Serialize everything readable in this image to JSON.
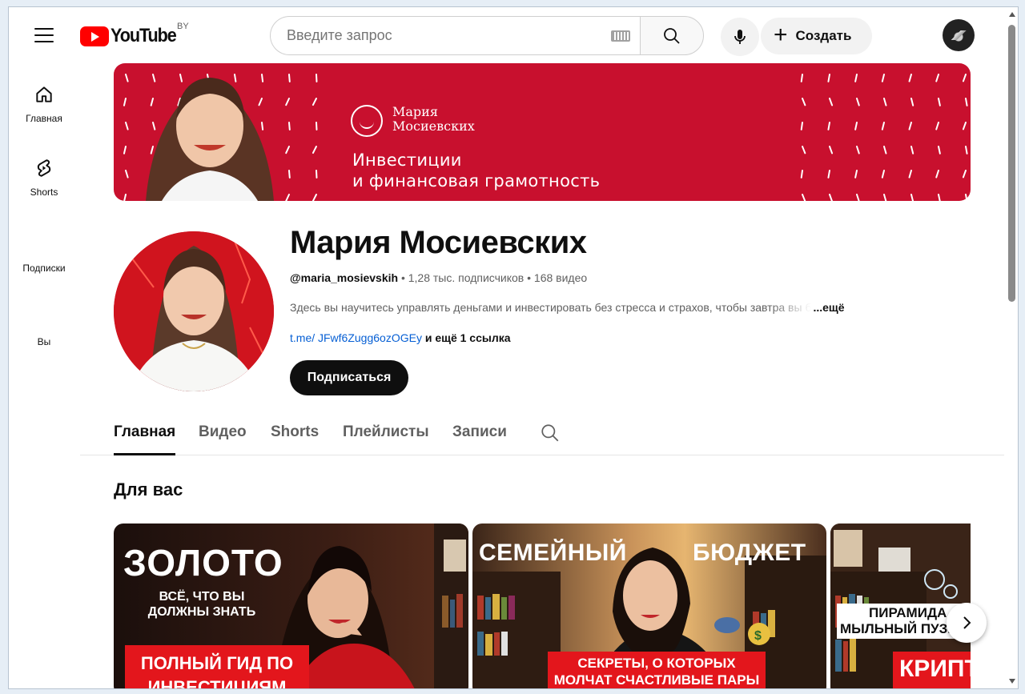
{
  "header": {
    "logo_text": "YouTube",
    "region": "BY",
    "search_placeholder": "Введите запрос",
    "create_label": "Создать"
  },
  "sidebar": {
    "items": [
      {
        "label": "Главная",
        "icon": "home-icon"
      },
      {
        "label": "Shorts",
        "icon": "shorts-icon"
      },
      {
        "label": "Подписки",
        "icon": "subscriptions-icon"
      },
      {
        "label": "Вы",
        "icon": "you-icon"
      }
    ]
  },
  "banner": {
    "name": [
      "Мария",
      "Мосиевских"
    ],
    "tagline": [
      "Инвестиции",
      "и финансовая грамотность"
    ],
    "color": "#c8102e"
  },
  "channel": {
    "title": "Мария Мосиевских",
    "handle": "@maria_mosievskih",
    "subscribers": "1,28 тыс. подписчиков",
    "videos": "168 видео",
    "separator": " • ",
    "description": "Здесь вы научитесь управлять деньгами и инвестировать без стресса и страхов, чтобы завтра вы б",
    "more": "...ещё",
    "link": "t.me/ JFwf6Zugg6ozOGEy",
    "link_extra": " и ещё 1 ссылка",
    "subscribe_label": "Подписаться"
  },
  "tabs": [
    {
      "label": "Главная",
      "active": true
    },
    {
      "label": "Видео",
      "active": false
    },
    {
      "label": "Shorts",
      "active": false
    },
    {
      "label": "Плейлисты",
      "active": false
    },
    {
      "label": "Записи",
      "active": false
    }
  ],
  "section_title": "Для вас",
  "videos": [
    {
      "headline": "ЗОЛОТО",
      "sub": [
        "ВСЁ, ЧТО ВЫ",
        "ДОЛЖНЫ ЗНАТЬ"
      ],
      "badge": [
        "ПОЛНЫЙ ГИД ПО",
        "ИНВЕСТИЦИЯМ"
      ]
    },
    {
      "headline_left": "СЕМЕЙНЫЙ",
      "headline_right": "БЮДЖЕТ",
      "badge": [
        "СЕКРЕТЫ, О КОТОРЫХ",
        "МОЛЧАТ СЧАСТЛИВЫЕ ПАРЫ"
      ]
    },
    {
      "headline": [
        "ПИРАМИДА",
        "МЫЛЬНЫЙ ПУЗЫРЬ"
      ],
      "badge": "КРИПТ"
    }
  ],
  "colors": {
    "accent": "#ff0000",
    "brand_red": "#e3161c",
    "link": "#065fd4"
  }
}
